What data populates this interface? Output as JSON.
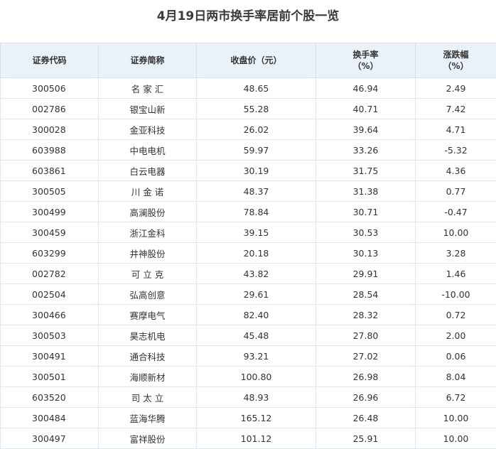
{
  "title": "4月19日两市换手率居前个股一览",
  "table": {
    "headers": [
      [
        "证券代码"
      ],
      [
        "证券简称"
      ],
      [
        "收盘价（元）"
      ],
      [
        "换手率",
        "（%）"
      ],
      [
        "涨跌幅",
        "（%）"
      ]
    ],
    "rows": [
      [
        "300506",
        "名 家 汇",
        "48.65",
        "46.94",
        "2.49"
      ],
      [
        "002786",
        "银宝山新",
        "55.28",
        "40.71",
        "7.42"
      ],
      [
        "300028",
        "金亚科技",
        "26.02",
        "39.64",
        "4.71"
      ],
      [
        "603988",
        "中电电机",
        "59.97",
        "33.26",
        "-5.32"
      ],
      [
        "603861",
        "白云电器",
        "30.19",
        "31.75",
        "4.36"
      ],
      [
        "300505",
        "川 金 诺",
        "48.37",
        "31.38",
        "0.77"
      ],
      [
        "300499",
        "高澜股份",
        "78.84",
        "30.71",
        "-0.47"
      ],
      [
        "300459",
        "浙江金科",
        "39.15",
        "30.53",
        "10.00"
      ],
      [
        "603299",
        "井神股份",
        "20.18",
        "30.13",
        "3.28"
      ],
      [
        "002782",
        "可 立 克",
        "43.82",
        "29.91",
        "1.46"
      ],
      [
        "002504",
        "弘高创意",
        "29.61",
        "28.54",
        "-10.00"
      ],
      [
        "300466",
        "赛摩电气",
        "82.40",
        "28.32",
        "0.72"
      ],
      [
        "300503",
        "昊志机电",
        "45.48",
        "27.80",
        "2.00"
      ],
      [
        "300491",
        "通合科技",
        "93.21",
        "27.02",
        "0.06"
      ],
      [
        "300501",
        "海顺新材",
        "100.80",
        "26.98",
        "8.04"
      ],
      [
        "603520",
        "司 太 立",
        "48.93",
        "26.96",
        "6.72"
      ],
      [
        "300484",
        "蓝海华腾",
        "165.12",
        "26.48",
        "10.00"
      ],
      [
        "300497",
        "富祥股份",
        "101.12",
        "25.91",
        "10.00"
      ]
    ]
  },
  "colors": {
    "header_bg": "#e9f1f9",
    "border": "#dfe8f1"
  }
}
